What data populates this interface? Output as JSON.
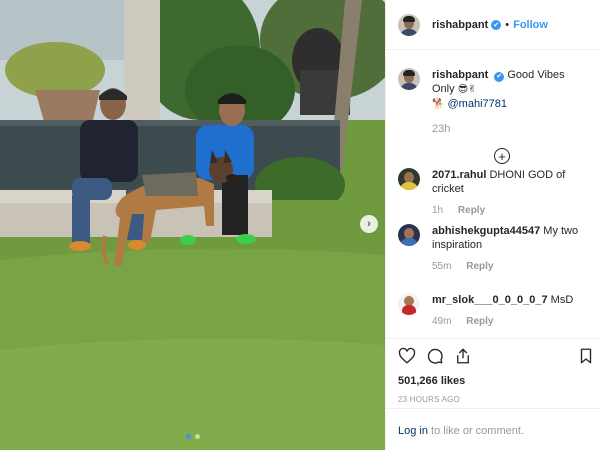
{
  "post": {
    "username": "rishabpant",
    "verified_mark": "✔",
    "separator": "•",
    "follow_label": "Follow",
    "caption_text": "Good Vibes Only",
    "caption_emojis": "😎✌",
    "caption_emoji2": "🐕",
    "caption_mention": "@mahi7781",
    "caption_time": "23h",
    "load_more_symbol": "+"
  },
  "comments": [
    {
      "user": "2071.rahul",
      "text": "DHONI GOD of cricket",
      "time": "1h",
      "reply": "Reply"
    },
    {
      "user": "abhishekgupta44547",
      "text": "My two inspiration",
      "time": "55m",
      "reply": "Reply"
    },
    {
      "user": "mr_slok___0_0_0_0_7",
      "text": "MsD",
      "time": "49m",
      "reply": "Reply"
    }
  ],
  "stats": {
    "likes": "501,266 likes",
    "posted_ago": "23 HOURS AGO"
  },
  "footer": {
    "login_link": "Log in",
    "login_rest": " to like or comment."
  },
  "icons": {
    "like": "heart-icon",
    "comment": "comment-bubble-icon",
    "share": "share-icon",
    "save": "bookmark-icon",
    "next": "chevron-right-icon"
  },
  "carousel": {
    "slide_count": 2,
    "active_index": 0
  },
  "colors": {
    "accent": "#3897f0",
    "link": "#003569",
    "muted": "#999999"
  }
}
